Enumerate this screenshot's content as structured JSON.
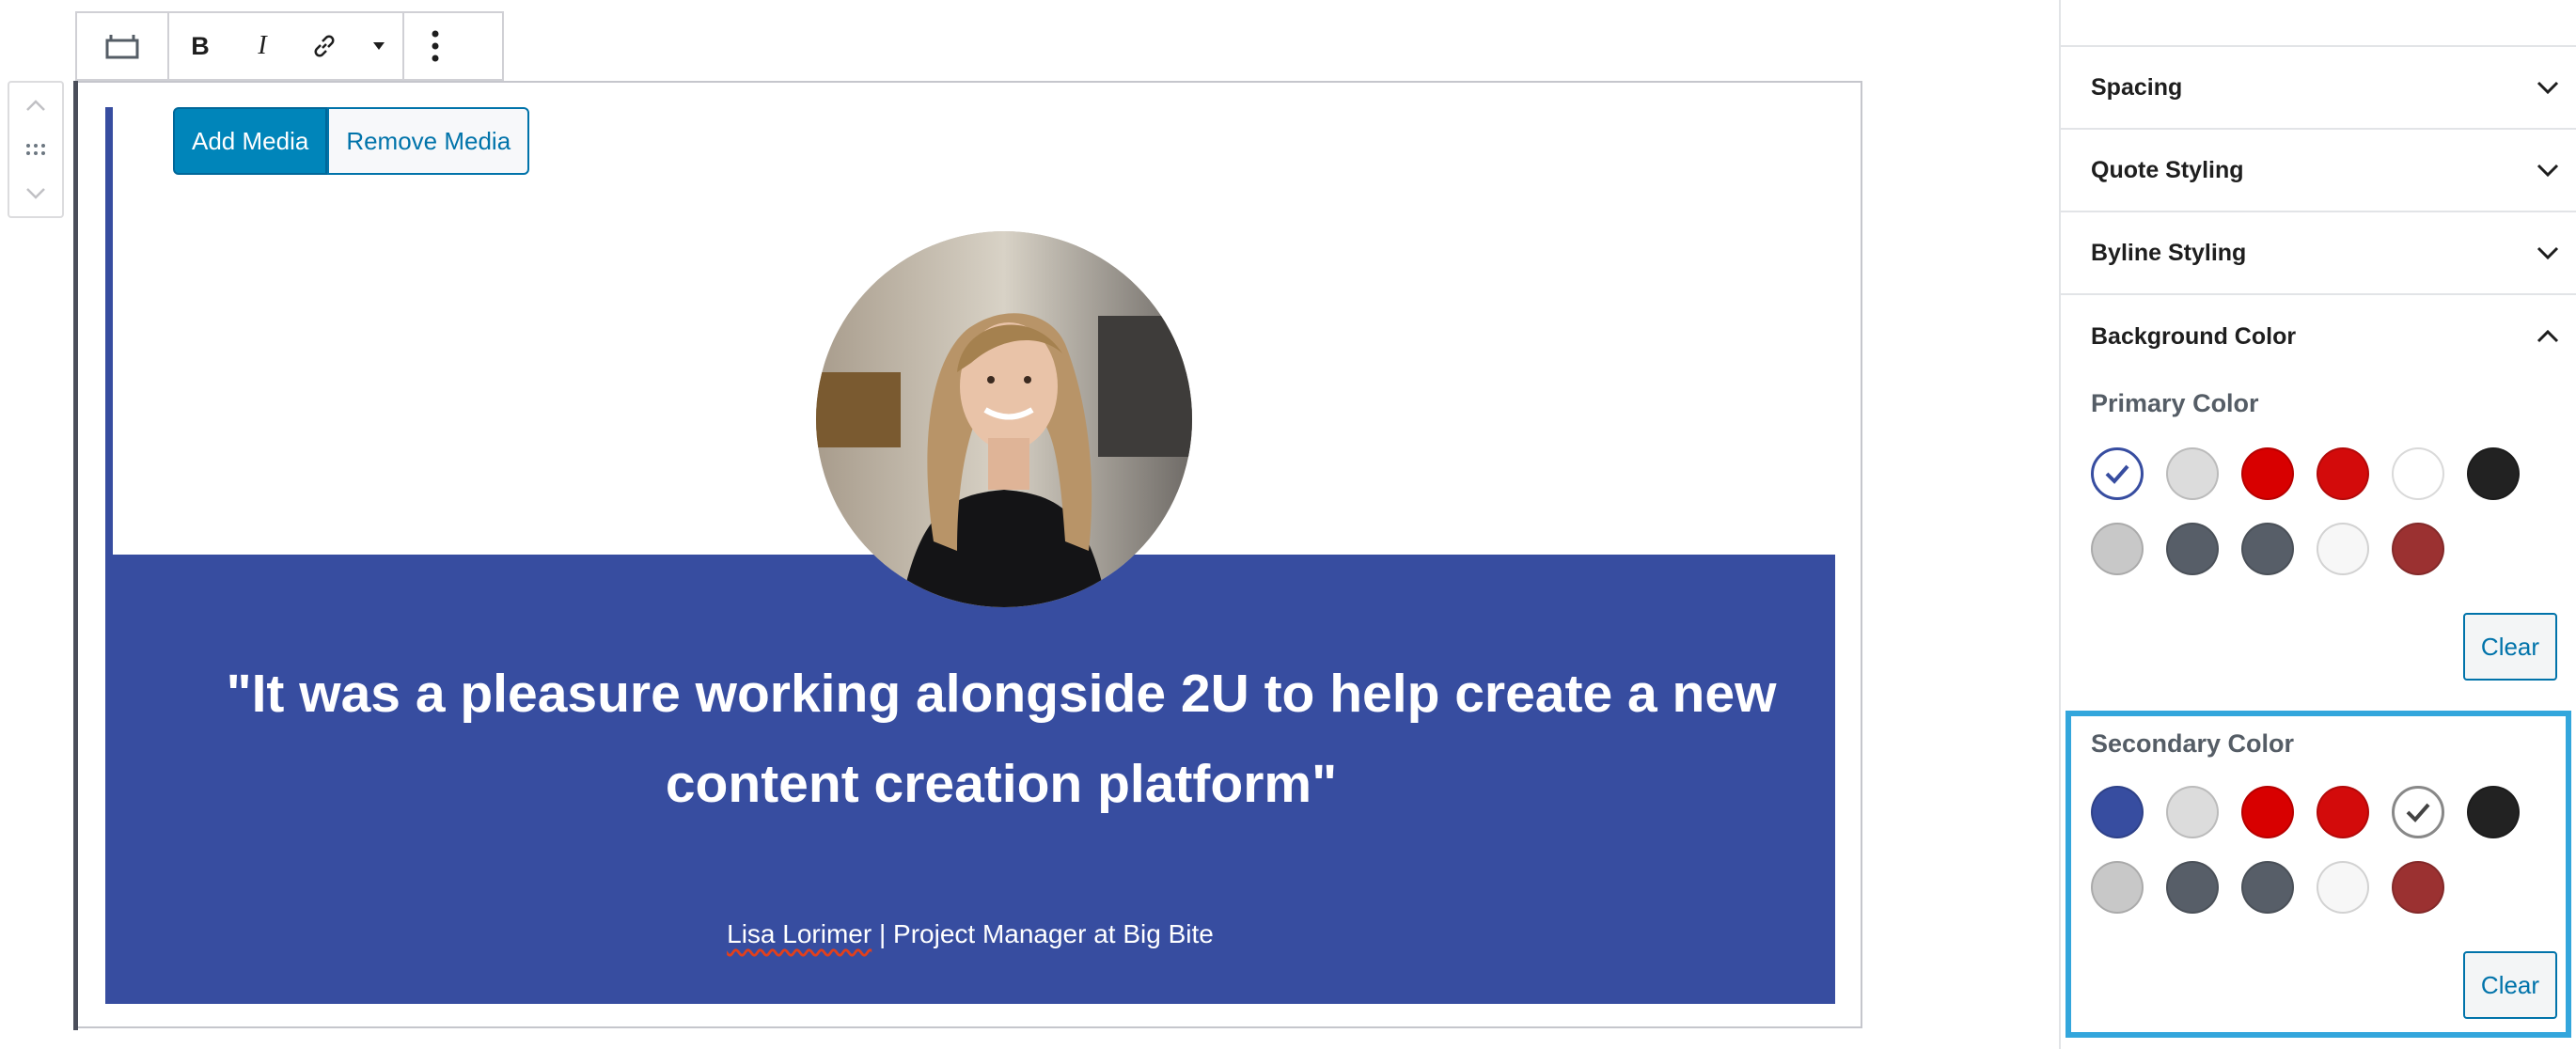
{
  "toolbar": {
    "block_icon": "media-text-block-icon",
    "bold_label": "B",
    "italic_label": "I",
    "link_icon": "link-icon",
    "more_icon": "caret-down-icon",
    "options_icon": "vertical-ellipsis-icon"
  },
  "mover": {
    "up_icon": "chevron-up-icon",
    "drag_icon": "drag-handle-icon",
    "down_icon": "chevron-down-icon"
  },
  "block": {
    "add_media_label": "Add Media",
    "remove_media_label": "Remove Media",
    "quote": "\"It was a pleasure working alongside 2U to help create a new content creation platform\"",
    "byline_name": "Lisa Lorimer",
    "byline_rest": " | Project Manager at Big Bite",
    "accent_color": "#374da0"
  },
  "sidebar": {
    "panels": [
      {
        "label": "Spacing",
        "state": "collapsed"
      },
      {
        "label": "Quote Styling",
        "state": "collapsed"
      },
      {
        "label": "Byline Styling",
        "state": "collapsed"
      },
      {
        "label": "Background Color",
        "state": "expanded"
      }
    ],
    "primary": {
      "label": "Primary Color",
      "selected_index": 0,
      "swatches": [
        "#374da0",
        "#dcdcdc",
        "#d80000",
        "#d30b0b",
        "#ffffff",
        "#222222",
        "#c8c8c8",
        "#575e68",
        "#575e68",
        "#f7f7f7",
        "#9b3131"
      ],
      "clear_label": "Clear"
    },
    "secondary": {
      "label": "Secondary Color",
      "selected_index": 4,
      "swatches": [
        "#374da0",
        "#dcdcdc",
        "#d80000",
        "#d30b0b",
        "#ffffff",
        "#222222",
        "#c8c8c8",
        "#575e68",
        "#575e68",
        "#f7f7f7",
        "#9b3131"
      ],
      "clear_label": "Clear"
    }
  }
}
